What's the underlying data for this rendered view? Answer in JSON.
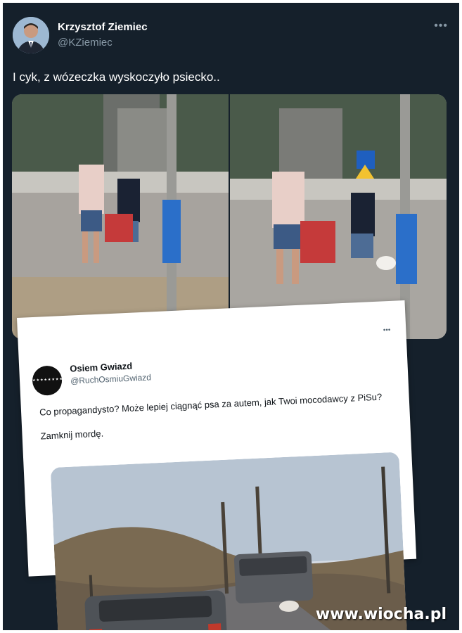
{
  "tweet": {
    "author_name": "Krzysztof Ziemiec",
    "author_handle": "@KZiemiec",
    "text": "I cyk, z wózeczka wyskoczyło psiecko..",
    "more_icon": "more-horizontal-icon"
  },
  "quoted_tweet": {
    "author_name": "Osiem Gwiazd",
    "author_handle": "@RuchOsmiuGwiazd",
    "text_line1": "Co propagandysto? Może lepiej ciągnąć psa za autem, jak Twoi mocodawcy z PiSu?",
    "text_line2": "Zamknij mordę.",
    "more_icon": "more-horizontal-icon"
  },
  "watermark": "www.wiocha.pl",
  "colors": {
    "background": "#15202b",
    "text_primary": "#ffffff",
    "text_secondary": "#8899a6",
    "quoted_background": "#ffffff"
  }
}
